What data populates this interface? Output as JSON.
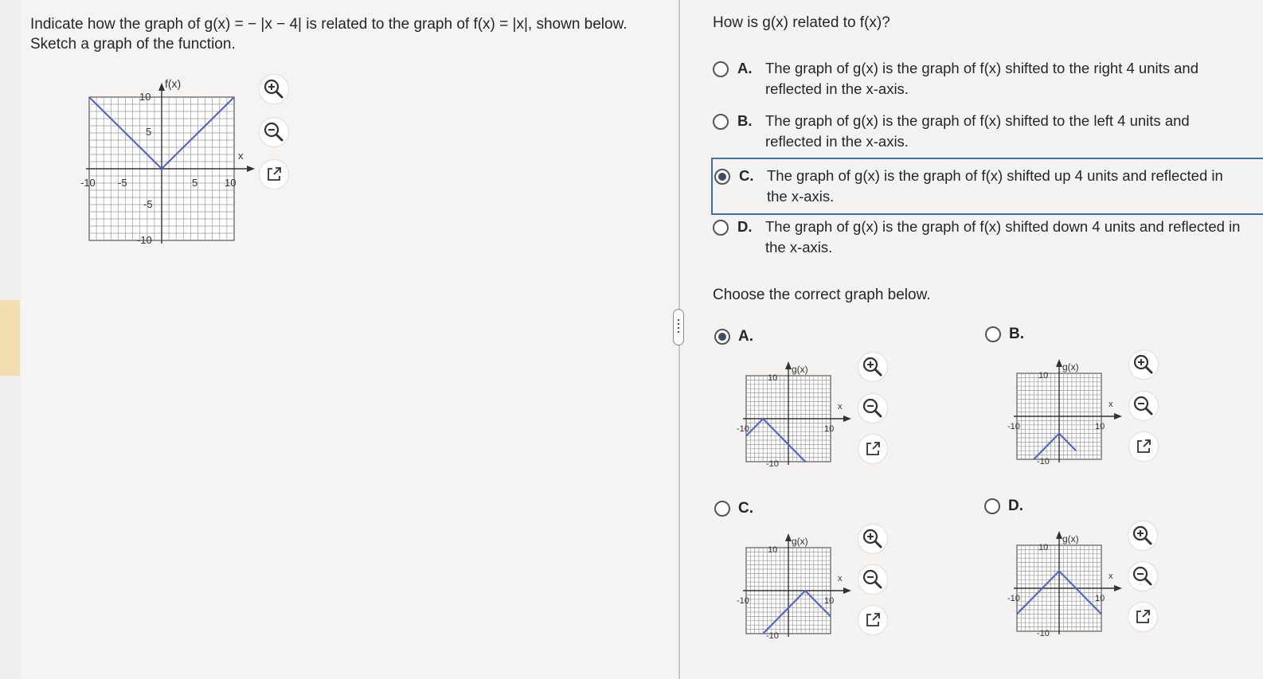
{
  "question": {
    "text": "Indicate how the graph of g(x) = − |x − 4| is related to the graph of f(x) = |x|,  shown below. Sketch a graph of the function.",
    "graph_ylabel": "f(x)",
    "graph_xlabel": "x",
    "ticks": {
      "neg10": "-10",
      "neg5": "-5",
      "pos5": "5",
      "pos10": "10"
    }
  },
  "part1": {
    "prompt": "How is g(x) related to f(x)?",
    "options": [
      {
        "letter": "A.",
        "text": "The graph of g(x) is the graph of f(x) shifted to the right 4 units and reflected in the x-axis.",
        "selected": false
      },
      {
        "letter": "B.",
        "text": "The graph of g(x) is the graph of f(x) shifted to the left 4 units and reflected in the x-axis.",
        "selected": false
      },
      {
        "letter": "C.",
        "text": "The graph of g(x) is the graph of f(x) shifted up 4 units and reflected in the x-axis.",
        "selected": true
      },
      {
        "letter": "D.",
        "text": "The graph of g(x) is the graph of f(x) shifted down 4 units and reflected in the x-axis.",
        "selected": false
      }
    ]
  },
  "part2": {
    "prompt": "Choose the correct graph below.",
    "graph_ylabel": "g(x)",
    "graph_xlabel": "x",
    "choices": [
      {
        "letter": "A.",
        "selected": true
      },
      {
        "letter": "B.",
        "selected": false
      },
      {
        "letter": "C.",
        "selected": false
      },
      {
        "letter": "D.",
        "selected": false
      }
    ]
  },
  "icons": {
    "zoom_in": "zoom-in-icon",
    "zoom_out": "zoom-out-icon",
    "popout": "external-link-icon"
  },
  "colors": {
    "line": "#4a5fd0",
    "accent": "#3b6fb6",
    "grid": "#9a9a9a"
  },
  "chart_data": [
    {
      "type": "line",
      "name": "f(x) = |x|",
      "x": [
        -10,
        0,
        10
      ],
      "y": [
        10,
        0,
        10
      ],
      "xlim": [
        -10,
        10
      ],
      "ylim": [
        -10,
        10
      ]
    },
    {
      "type": "line",
      "name": "choice A",
      "x": [
        -10,
        -6,
        4,
        8
      ],
      "y": [
        -4,
        0,
        -10,
        -12
      ],
      "xlim": [
        -10,
        10
      ],
      "ylim": [
        -10,
        10
      ]
    },
    {
      "type": "line",
      "name": "choice B",
      "x": [
        -6,
        0,
        4
      ],
      "y": [
        -10,
        -4,
        -8
      ],
      "xlim": [
        -10,
        10
      ],
      "ylim": [
        -10,
        10
      ]
    },
    {
      "type": "line",
      "name": "choice C",
      "x": [
        -6,
        4,
        10
      ],
      "y": [
        -10,
        0,
        -6
      ],
      "xlim": [
        -10,
        10
      ],
      "ylim": [
        -10,
        10
      ]
    },
    {
      "type": "line",
      "name": "choice D",
      "x": [
        -10,
        0,
        10
      ],
      "y": [
        -6,
        4,
        -6
      ],
      "xlim": [
        -10,
        10
      ],
      "ylim": [
        -10,
        10
      ]
    }
  ]
}
